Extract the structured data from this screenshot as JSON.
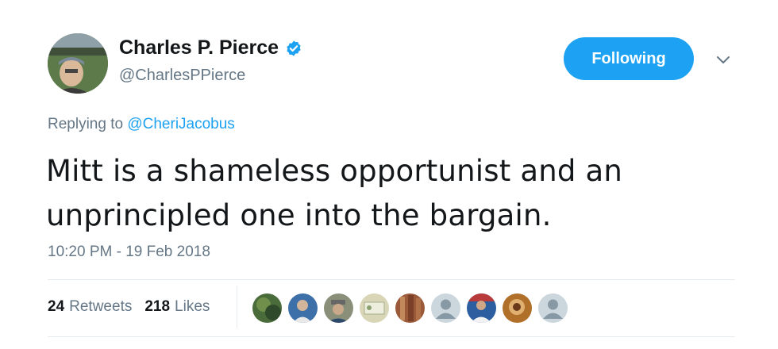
{
  "author": {
    "name": "Charles P. Pierce",
    "handle": "@CharlesPPierce",
    "verified": true
  },
  "follow_button": {
    "label": "Following"
  },
  "menu": {
    "icon": "chevron-down-icon"
  },
  "reply": {
    "prefix": "Replying to ",
    "mention": "@CheriJacobus"
  },
  "tweet": {
    "text": "Mitt is a shameless opportunist and an unprincipled one into the bargain."
  },
  "timestamp": "10:20 PM - 19 Feb 2018",
  "stats": {
    "retweets_count": "24",
    "retweets_label": "Retweets",
    "likes_count": "218",
    "likes_label": "Likes"
  },
  "likers": [
    {
      "icon": "liker-avatar-1",
      "color": "#4a6b3a"
    },
    {
      "icon": "liker-avatar-2",
      "color": "#3d6fa8"
    },
    {
      "icon": "liker-avatar-3",
      "color": "#8a8f7a"
    },
    {
      "icon": "liker-avatar-4",
      "color": "#d9d6b8"
    },
    {
      "icon": "liker-avatar-5",
      "color": "#9a5a3a"
    },
    {
      "icon": "default-avatar-icon",
      "color": "#ccd6dd"
    },
    {
      "icon": "liker-avatar-7",
      "color": "#2d5fa0"
    },
    {
      "icon": "liker-avatar-8",
      "color": "#b0702a"
    },
    {
      "icon": "default-avatar-icon",
      "color": "#ccd6dd"
    }
  ],
  "colors": {
    "accent": "#1da1f2",
    "secondary_text": "#657786",
    "primary_text": "#14171a",
    "divider": "#e6ecf0"
  }
}
